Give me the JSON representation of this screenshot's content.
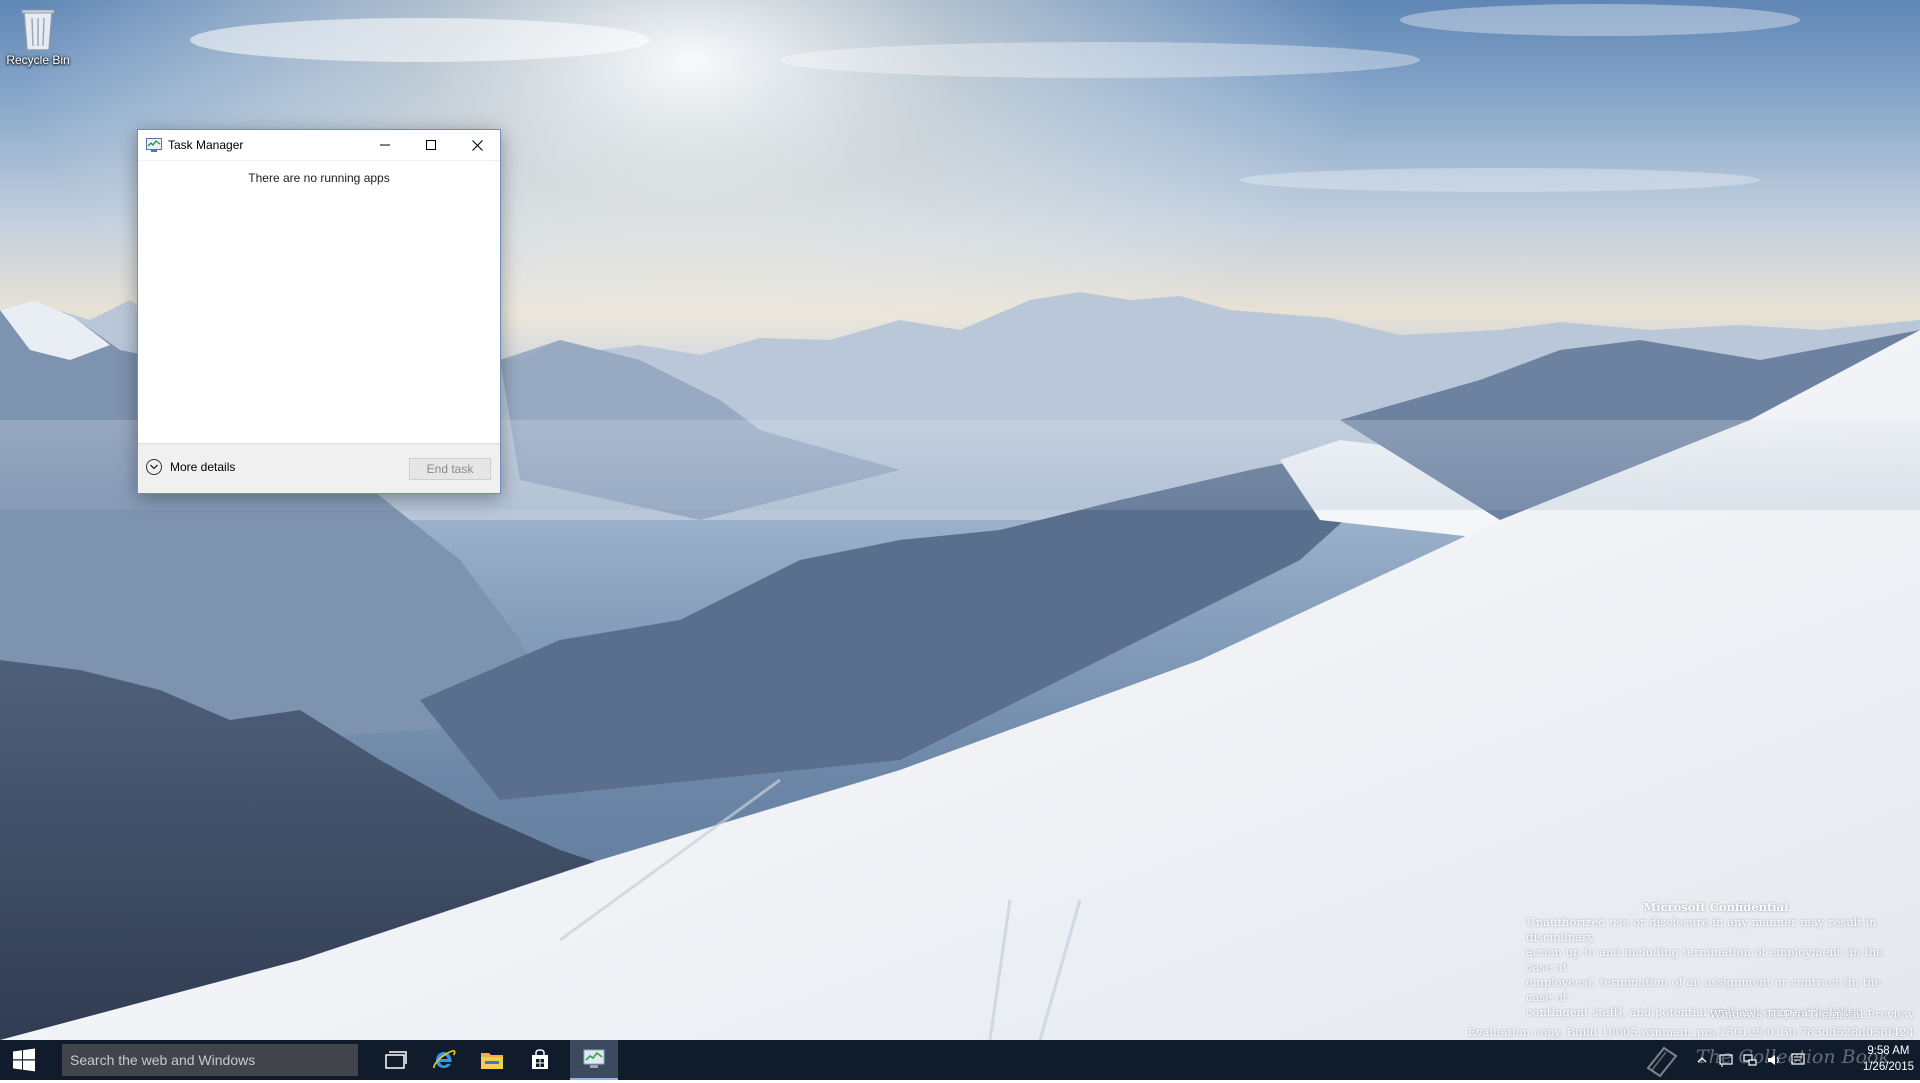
{
  "desktop": {
    "icons": [
      {
        "label": "Recycle Bin",
        "icon": "recycle-bin-icon"
      }
    ]
  },
  "task_manager": {
    "title": "Task Manager",
    "empty_message": "There are no running apps",
    "more_details_label": "More details",
    "end_task_label": "End task",
    "end_task_enabled": false
  },
  "watermark": {
    "title": "Microsoft Confidential",
    "lines": [
      "Unauthorized use or disclosure in any manner may result in disciplinary",
      "action up to and including termination of employment (in the case of",
      "employees), termination of an assignment or contract (in the case of",
      "contingent staff), and potential civil and criminal liability."
    ],
    "edition": "Windows 10 Pro Technical Preview",
    "build": "Evaluation copy. Build 10005.winmain_prs.150125-0130.783dd528d056f424"
  },
  "taskbar": {
    "search_placeholder": "Search the web and Windows",
    "pinned": [
      "task-view-icon",
      "internet-explorer-icon",
      "file-explorer-icon",
      "store-icon",
      "task-manager-icon"
    ],
    "active": "task-manager-icon",
    "tray_watermark": "The Collection Book",
    "clock_time": "9:58 AM",
    "clock_date": "1/26/2015"
  },
  "colors": {
    "taskbar": "#101c2c",
    "search_box": "#41444a",
    "window_border": "#6f8fb8",
    "active_accent": "#8eb6e8"
  }
}
